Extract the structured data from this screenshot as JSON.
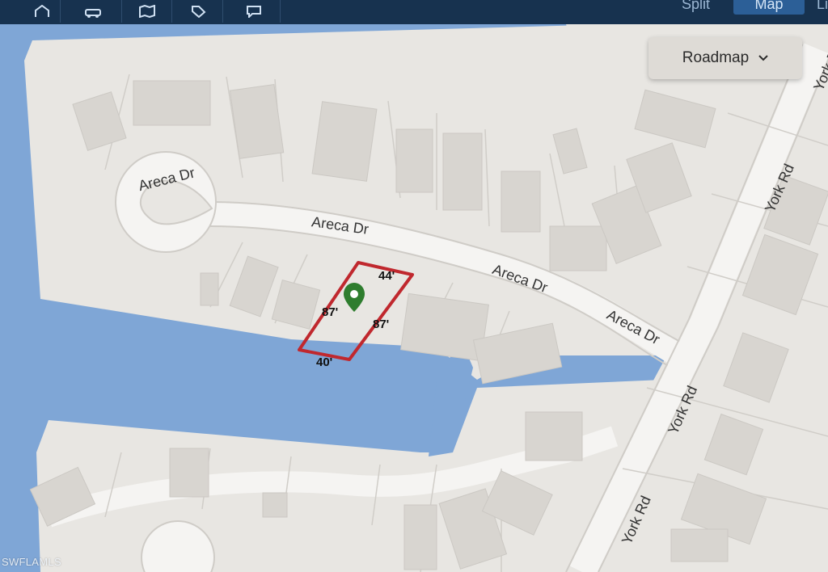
{
  "toolbar": {
    "icons": [
      "home-icon",
      "car-icon",
      "map-icon",
      "tag-icon",
      "chat-icon"
    ],
    "views": {
      "split": "Split",
      "map": "Map",
      "list": "Li"
    }
  },
  "map_type_button": {
    "label": "Roadmap"
  },
  "streets": {
    "cul_de_sac": "Areca Dr",
    "areca_1": "Areca Dr",
    "areca_2": "Areca Dr",
    "areca_3": "Areca Dr",
    "york_1": "York Rd",
    "york_2": "York Rd",
    "york_3": "York Rd",
    "york_4": "York Rd"
  },
  "parcel": {
    "top": "44'",
    "left": "87'",
    "right": "87'",
    "bottom": "40'",
    "outline_color": "#c0282e",
    "pin_color": "#2e7d2e"
  },
  "colors": {
    "water": "#7fa6d6",
    "land": "#e8e6e2",
    "building": "#d8d5d0",
    "toolbar": "#17324f"
  },
  "watermark": "SWFLAMLS"
}
